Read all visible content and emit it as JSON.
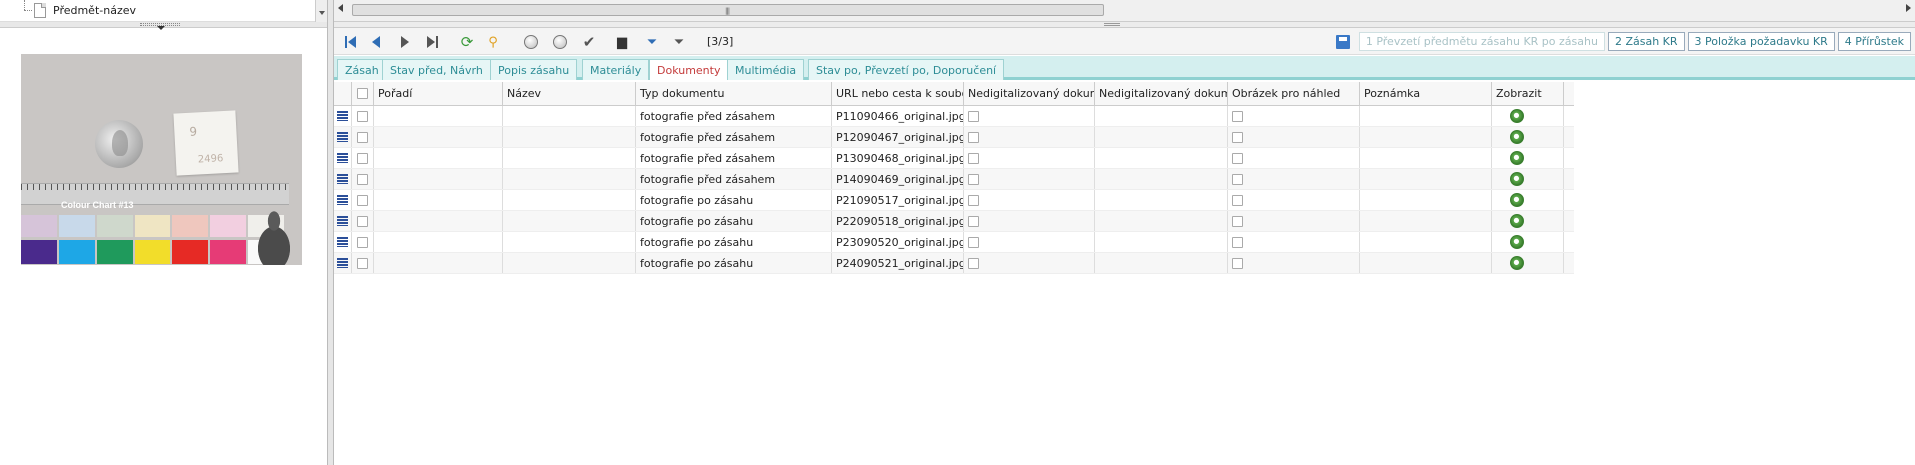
{
  "left_panel": {
    "tree_item_label": "Předmět-název",
    "image_card_note_top": "9",
    "image_card_note_bottom": "2496",
    "color_chart_label": "Colour Chart #13",
    "swatches_top": [
      "#d6c4d9",
      "#c8d9ea",
      "#cfd8cc",
      "#efe5c3",
      "#efc7be",
      "#f2cfe0",
      "#f0efeb"
    ],
    "swatches_bottom": [
      "#4a2a8c",
      "#1ea7e6",
      "#1f9a5c",
      "#f2dd2a",
      "#e62a25",
      "#e63b76",
      "#fafafa"
    ]
  },
  "toolbar": {
    "page_counter": "[3/3]",
    "buttons": [
      {
        "label": "1 Převzetí předmětu zásahu KR po zásahu",
        "enabled": false
      },
      {
        "label": "2 Zásah KR",
        "enabled": true
      },
      {
        "label": "3 Položka požadavku KR",
        "enabled": true
      },
      {
        "label": "4 Přírůstek",
        "enabled": true
      }
    ]
  },
  "tabs": [
    "Zásah",
    "Stav před, Návrh",
    "Popis zásahu",
    "Materiály",
    "Dokumenty",
    "Multimédia",
    "Stav po, Převzetí po, Doporučení"
  ],
  "active_tab": "Dokumenty",
  "table": {
    "columns": [
      "Pořadí",
      "Název",
      "Typ dokumentu",
      "URL nebo cesta k soubo",
      "Nedigitalizovaný dokum",
      "Nedigitalizovaný dokum",
      "Obrázek pro náhled",
      "Poznámka",
      "Zobrazit"
    ],
    "rows": [
      {
        "typ": "fotografie před zásahem",
        "url": "P11090466_original.jpg"
      },
      {
        "typ": "fotografie před zásahem",
        "url": "P12090467_original.jpg"
      },
      {
        "typ": "fotografie před zásahem",
        "url": "P13090468_original.jpg"
      },
      {
        "typ": "fotografie před zásahem",
        "url": "P14090469_original.jpg"
      },
      {
        "typ": "fotografie po zásahu",
        "url": "P21090517_original.jpg"
      },
      {
        "typ": "fotografie po zásahu",
        "url": "P22090518_original.jpg"
      },
      {
        "typ": "fotografie po zásahu",
        "url": "P23090520_original.jpg"
      },
      {
        "typ": "fotografie po zásahu",
        "url": "P24090521_original.jpg"
      }
    ]
  },
  "colors": {
    "tab_bg": "#d4efef",
    "tab_text": "#2d8d96",
    "active_tab_text": "#c43b3b",
    "nav_blue": "#2f6db5"
  }
}
